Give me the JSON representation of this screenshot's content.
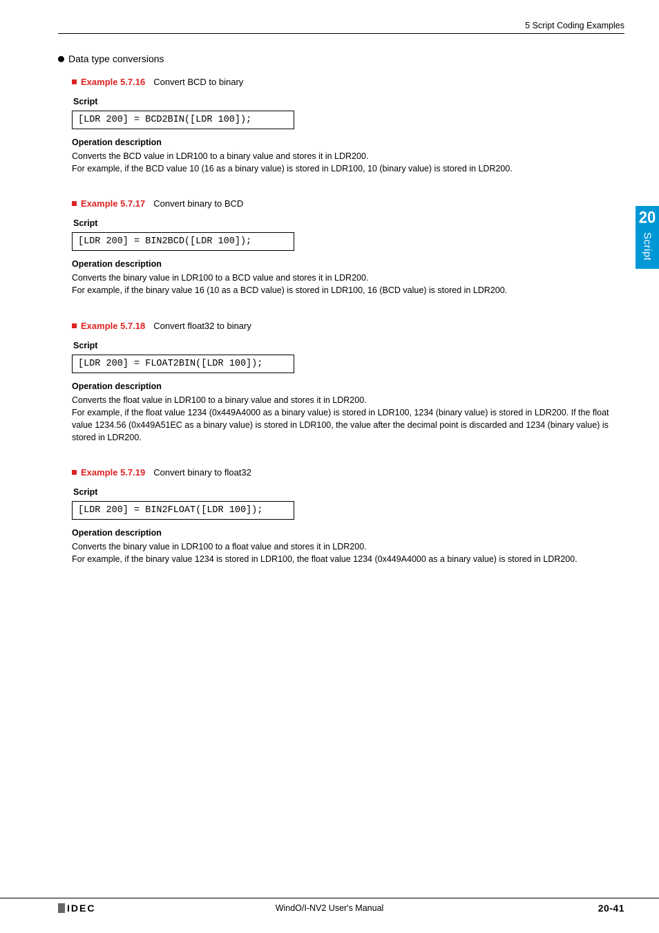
{
  "header": {
    "section_ref": "5 Script Coding Examples"
  },
  "sidebar": {
    "chapter_number": "20",
    "chapter_label": "Script"
  },
  "section_title": "Data type conversions",
  "examples": [
    {
      "num": "Example 5.7.16",
      "title": "Convert BCD to binary",
      "script_label": "Script",
      "code": "[LDR 200] = BCD2BIN([LDR 100]);",
      "op_label": "Operation description",
      "op_lines": [
        "Converts the BCD value in LDR100 to a binary value and stores it in LDR200.",
        "For example, if the BCD value 10 (16 as a binary value) is stored in LDR100, 10 (binary value) is stored in LDR200."
      ]
    },
    {
      "num": "Example 5.7.17",
      "title": "Convert binary to BCD",
      "script_label": "Script",
      "code": "[LDR 200] = BIN2BCD([LDR 100]);",
      "op_label": "Operation description",
      "op_lines": [
        "Converts the binary value in LDR100 to a BCD value and stores it in LDR200.",
        "For example, if the binary value 16 (10 as a BCD value) is stored in LDR100, 16 (BCD value) is stored in LDR200."
      ]
    },
    {
      "num": "Example 5.7.18",
      "title": "Convert float32 to binary",
      "script_label": "Script",
      "code": "[LDR 200] = FLOAT2BIN([LDR 100]);",
      "op_label": "Operation description",
      "op_lines": [
        "Converts the float value in LDR100 to a binary value and stores it in LDR200.",
        "For example, if the float value 1234 (0x449A4000 as a binary value) is stored in LDR100, 1234 (binary value) is stored in LDR200. If the float value 1234.56 (0x449A51EC as a binary value) is stored in LDR100, the value after the decimal point is discarded and 1234 (binary value) is stored in LDR200."
      ]
    },
    {
      "num": "Example 5.7.19",
      "title": "Convert binary to float32",
      "script_label": "Script",
      "code": "[LDR 200] = BIN2FLOAT([LDR 100]);",
      "op_label": "Operation description",
      "op_lines": [
        "Converts the binary value in LDR100 to a float value and stores it in LDR200.",
        "For example, if the binary value 1234 is stored in LDR100, the float value 1234 (0x449A4000 as a binary value) is stored in LDR200."
      ]
    }
  ],
  "footer": {
    "logo_text": "IDEC",
    "manual_title": "WindO/I-NV2 User's Manual",
    "page_number": "20-41"
  }
}
